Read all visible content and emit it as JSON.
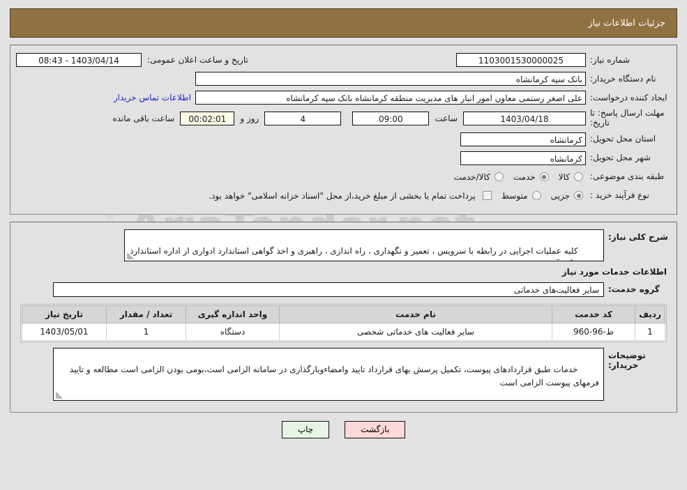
{
  "header": {
    "title": "جزئیات اطلاعات نیاز"
  },
  "form": {
    "need_number_label": "شماره نیاز:",
    "need_number_value": "1103001530000025",
    "public_announce_label": "تاریخ و ساعت اعلان عمومی:",
    "public_announce_value": "1403/04/14 - 08:43",
    "buyer_org_label": "نام دستگاه خریدار:",
    "buyer_org_value": "بانک سپه کرمانشاه",
    "creator_label": "ایجاد کننده درخواست:",
    "creator_value": "علی اصغر رستمی معاون امور انبار های مدیریت منطقه کرمانشاه بانک سپه کرمانشاه",
    "contact_link": "اطلاعات تماس خریدار",
    "deadline_label": "مهلت ارسال پاسخ: تا تاریخ:",
    "deadline_date": "1403/04/18",
    "hour_label": "ساعت",
    "deadline_time": "09:00",
    "days_remaining": "4",
    "days_and_label": "روز و",
    "countdown": "00:02:01",
    "hours_remaining_label": "ساعت باقی مانده",
    "province_label": "استان محل تحویل:",
    "province_value": "کرمانشاه",
    "city_label": "شهر محل تحویل:",
    "city_value": "کرمانشاه",
    "category_label": "طبقه بندی موضوعی:",
    "category_options": [
      {
        "label": "کالا",
        "selected": false
      },
      {
        "label": "خدمت",
        "selected": true
      },
      {
        "label": "کالا/خدمت",
        "selected": false
      }
    ],
    "purchase_type_label": "نوع فرآیند خرید :",
    "purchase_type_options": [
      {
        "label": "جزیی",
        "selected": true
      },
      {
        "label": "متوسط",
        "selected": false
      }
    ],
    "treasury_checkbox_checked": false,
    "treasury_note": "پرداخت تمام یا بخشی از مبلغ خرید،از محل \"اسناد خزانه اسلامی\" خواهد بود."
  },
  "description": {
    "label": "شرح کلی نیاز:",
    "value": "کلیه عملیات اجرایی در رابطه با سرویس ، تعمیر و نگهداری ، راه اندازی ، راهبری و اخذ گواهی استاندارد ادواری از اداره استاندارد یک دستگاه آسانسور"
  },
  "services_section": {
    "heading": "اطلاعات خدمات مورد نیاز",
    "group_label": "گروه خدمت:",
    "group_value": "سایر فعالیت‌های خدماتی",
    "table": {
      "columns": [
        "ردیف",
        "کد خدمت",
        "نام خدمت",
        "واحد اندازه گیری",
        "تعداد / مقدار",
        "تاریخ نیاز"
      ],
      "rows": [
        {
          "radif": "1",
          "code": "ط-96-960",
          "name": "سایر فعالیت های خدماتی شخصی",
          "unit": "دستگاه",
          "qty": "1",
          "date": "1403/05/01"
        }
      ]
    }
  },
  "buyer_notes": {
    "label": "توضیحات خریدار:",
    "value": "خدمات طبق قراردادهای پیوست، تکمیل پرسش بهای قرارداد تایید وامضاءوبارگذاری در سامانه الزامی است،بومی بودن الزامی است مطالعه و تایید فرمهای پیوست الزامی است"
  },
  "buttons": {
    "print": "چاپ",
    "back": "بازگشت"
  },
  "colors": {
    "header_bg": "#8e7242",
    "page_bg": "#e2e2e2",
    "link": "#2222cc",
    "timer_bg": "#fbfbe6",
    "print_btn_bg": "#e6f5e6",
    "back_btn_bg": "#fbd9d9"
  }
}
